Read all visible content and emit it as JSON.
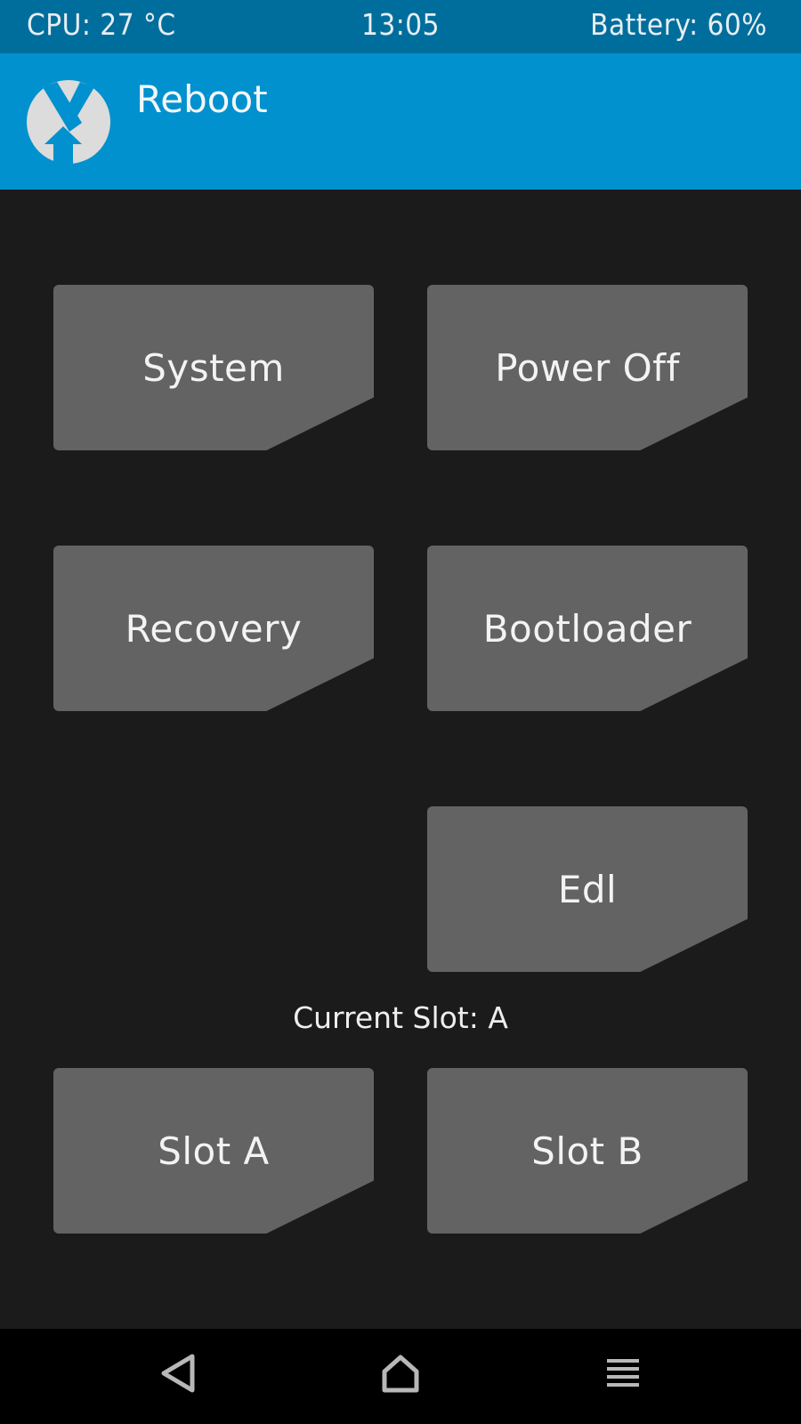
{
  "status_bar": {
    "cpu": "CPU: 27 °C",
    "time": "13:05",
    "battery": "Battery: 60%"
  },
  "header": {
    "title": "Reboot",
    "logo_icon": "twrp-logo-icon"
  },
  "buttons": {
    "system": "System",
    "power_off": "Power Off",
    "recovery": "Recovery",
    "bootloader": "Bootloader",
    "edl": "Edl",
    "slot_a": "Slot A",
    "slot_b": "Slot B"
  },
  "current_slot": "Current Slot: A",
  "nav_bar": {
    "back_icon": "back-icon",
    "home_icon": "home-icon",
    "menu_icon": "menu-icon"
  },
  "colors": {
    "status_bar": "#006e9c",
    "header": "#0091ce",
    "background": "#1b1b1b",
    "button": "#636363",
    "nav_bar": "#000000"
  }
}
